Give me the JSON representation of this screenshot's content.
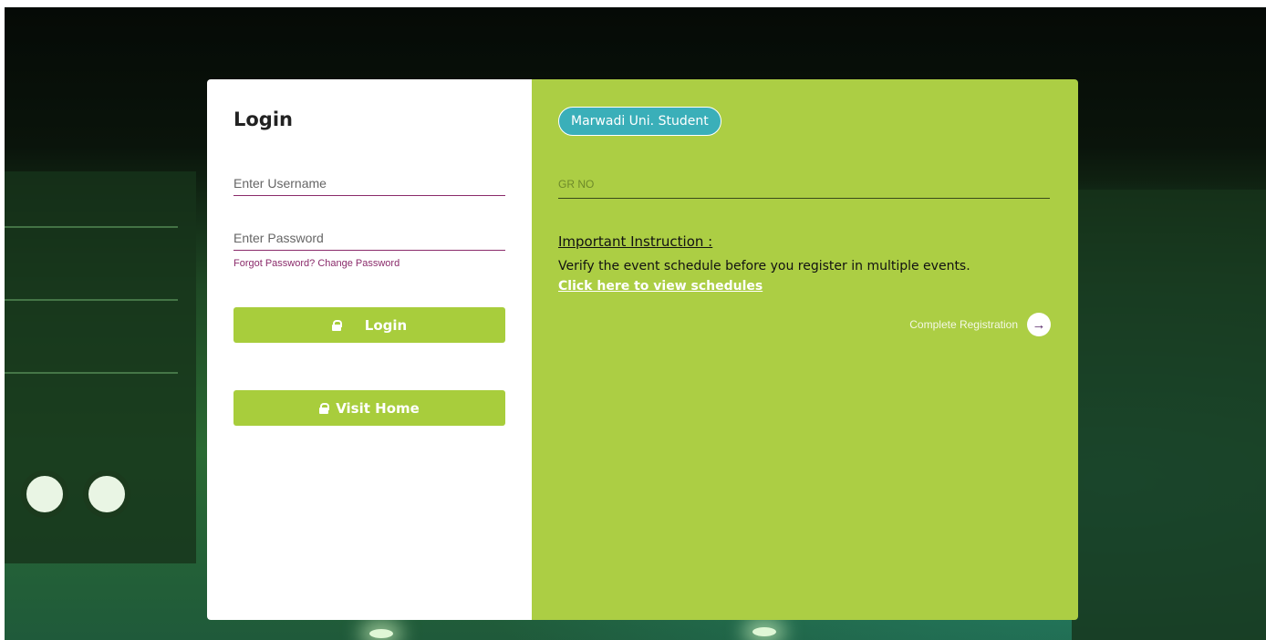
{
  "login": {
    "title": "Login",
    "username_placeholder": "Enter Username",
    "password_placeholder": "Enter Password",
    "forgot_text": "Forgot Password? Change Password",
    "login_button": "Login",
    "visit_home_button": "Visit Home"
  },
  "student": {
    "badge": "Marwadi Uni. Student",
    "gr_placeholder": "GR NO",
    "instruction_title": "Important Instruction :",
    "instruction_text": "Verify the event schedule before you register in multiple events.",
    "schedule_link": "Click here to view schedules",
    "complete_label": "Complete Registration"
  },
  "colors": {
    "accent_green": "#acce44",
    "button_green": "#a8cd3c",
    "badge_teal": "#3aafb9",
    "underline_purple": "#8a2a6a"
  },
  "icons": [
    "lock-icon",
    "arrow-right-circle-icon"
  ]
}
